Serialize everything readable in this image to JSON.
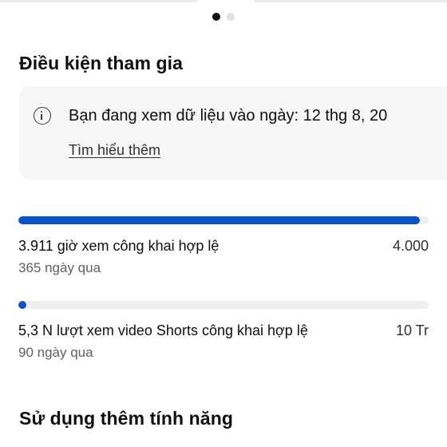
{
  "carousel": {
    "total": 2,
    "active_index": 0
  },
  "eligibility": {
    "title": "Điều kiện tham gia",
    "info": {
      "icon": "info-icon",
      "text": "Bạn đang xem dữ liệu vào ngày: 12 thg 8, 20",
      "link_label": "Tìm hiểu thêm"
    },
    "metrics": [
      {
        "label": "3.911 giờ xem công khai hợp lệ",
        "period": "365 ngày qua",
        "target": "4.000",
        "progress_fraction": 0.978
      },
      {
        "label": "5,3 N lượt xem video Shorts công khai hợp lệ",
        "period": "90 ngày qua",
        "target": "10 Tr",
        "progress_fraction": 0.0005
      }
    ]
  },
  "more_features": {
    "title": "Sử dụng thêm tính năng"
  },
  "colors": {
    "progress_fill": "#0a53c7",
    "progress_track": "#efefef"
  }
}
